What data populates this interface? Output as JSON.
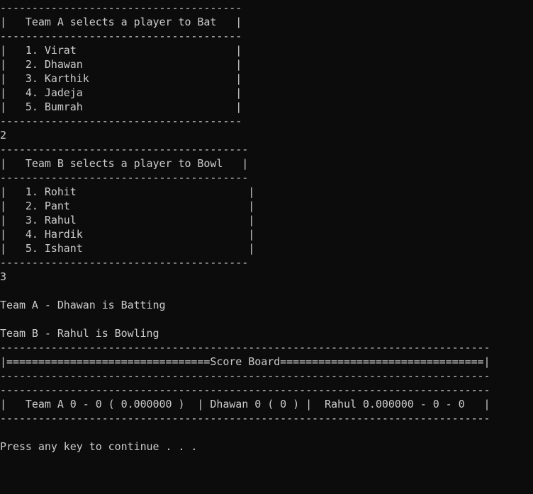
{
  "console": {
    "lines": [
      "--------------------------------------",
      "|   Team A selects a player to Bat   |",
      "--------------------------------------",
      "|   1. Virat                         |",
      "|   2. Dhawan                        |",
      "|   3. Karthik                       |",
      "|   4. Jadeja                        |",
      "|   5. Bumrah                        |",
      "--------------------------------------",
      "2",
      "---------------------------------------",
      "|   Team B selects a player to Bowl   |",
      "---------------------------------------",
      "|   1. Rohit                           |",
      "|   2. Pant                            |",
      "|   3. Rahul                           |",
      "|   4. Hardik                          |",
      "|   5. Ishant                          |",
      "---------------------------------------",
      "3",
      "",
      "Team A - Dhawan is Batting",
      "",
      "Team B - Rahul is Bowling",
      "-----------------------------------------------------------------------------",
      "|================================Score Board================================|",
      "-----------------------------------------------------------------------------",
      "-----------------------------------------------------------------------------",
      "|   Team A 0 - 0 ( 0.000000 )  | Dhawan 0 ( 0 ) |  Rahul 0.000000 - 0 - 0   |",
      "-----------------------------------------------------------------------------",
      "",
      "Press any key to continue . . ."
    ]
  }
}
